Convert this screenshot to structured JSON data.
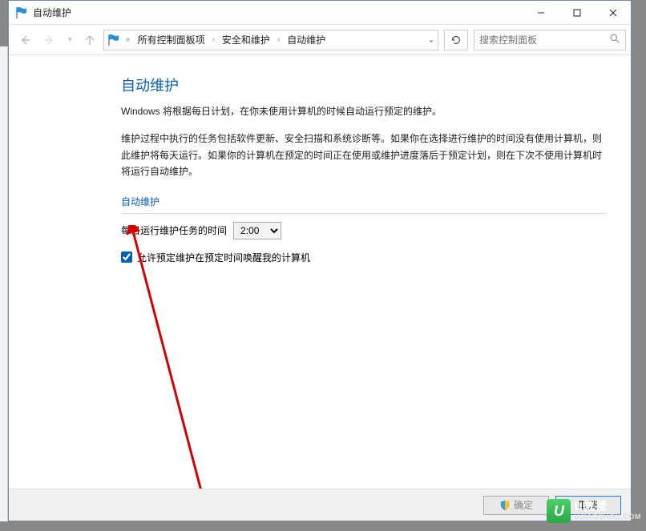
{
  "window": {
    "title": "自动维护"
  },
  "breadcrumb": {
    "items": [
      "所有控制面板项",
      "安全和维护",
      "自动维护"
    ]
  },
  "search": {
    "placeholder": "搜索控制面板"
  },
  "page": {
    "heading": "自动维护",
    "desc1": "Windows 将根据每日计划，在你未使用计算机的时候自动运行预定的维护。",
    "desc2": "维护过程中执行的任务包括软件更新、安全扫描和系统诊断等。如果你在选择进行维护的时间没有使用计算机，则此维护将每天运行。如果你的计算机在预定的时间正在使用或维护进度落后于预定计划，则在下次不使用计算机时将运行自动维护。",
    "section_label": "自动维护",
    "time_label": "每日运行维护任务的时间",
    "time_value": "2:00",
    "checkbox_label": "允许预定维护在预定时间唤醒我的计算机"
  },
  "footer": {
    "ok": "确定",
    "cancel": "取消"
  },
  "watermark": {
    "text1": "U教授",
    "text2": "UJIAOSHOU.COM"
  }
}
